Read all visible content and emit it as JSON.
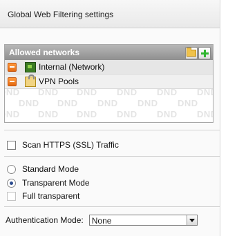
{
  "panel": {
    "title": "Global Web Filtering settings"
  },
  "allowed_networks": {
    "header": "Allowed networks",
    "rows": [
      {
        "label": "Internal (Network)",
        "icon": "network-icon"
      },
      {
        "label": "VPN Pools",
        "icon": "vpn-lock-icon"
      }
    ],
    "watermark": "DND"
  },
  "options": {
    "scan_https_label": "Scan HTTPS (SSL) Traffic",
    "scan_https_checked": false,
    "modes": [
      {
        "label": "Standard Mode",
        "selected": false
      },
      {
        "label": "Transparent Mode",
        "selected": true
      }
    ],
    "full_transparent_label": "Full transparent",
    "full_transparent_checked": false
  },
  "authentication": {
    "label": "Authentication Mode:",
    "value": "None"
  },
  "colors": {
    "header_gradient_top": "#b7b7b7",
    "header_gradient_bottom": "#8f8f8f",
    "delete_icon": "#e36a12",
    "add_icon": "#2fb52f"
  }
}
